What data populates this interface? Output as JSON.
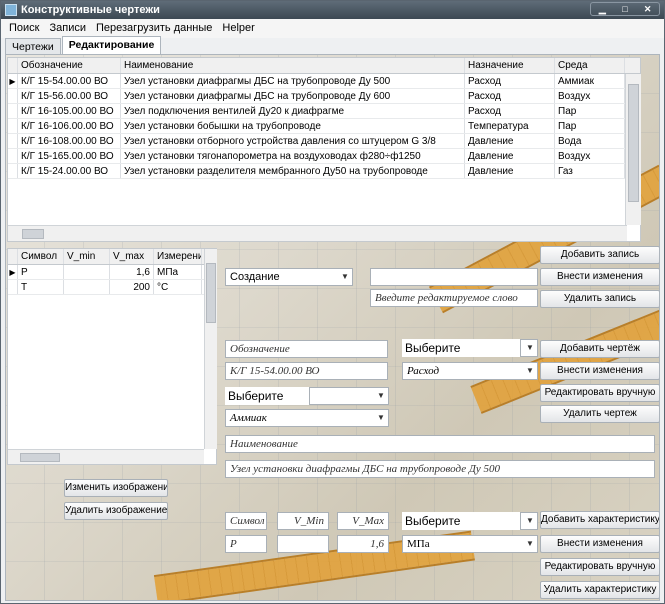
{
  "window": {
    "title": "Конструктивные чертежи"
  },
  "menu": {
    "items": [
      "Поиск",
      "Записи",
      "Перезагрузить данные",
      "Helper"
    ]
  },
  "tabs": [
    {
      "label": "Чертежи"
    },
    {
      "label": "Редактирование"
    }
  ],
  "drawings_table": {
    "columns": [
      "Обозначение",
      "Наименование",
      "Назначение",
      "Среда"
    ],
    "rows": [
      {
        "code": "К/Г 15-54.00.00 ВО",
        "name": "Узел установки диафрагмы ДБС на трубопроводе Ду 500",
        "purpose": "Расход",
        "medium": "Аммиак"
      },
      {
        "code": "К/Г 15-56.00.00 ВО",
        "name": "Узел установки диафрагмы ДБС на трубопроводе Ду 600",
        "purpose": "Расход",
        "medium": "Воздух"
      },
      {
        "code": "К/Г 16-105.00.00 ВО",
        "name": "Узел подключения вентилей Ду20 к диафрагме",
        "purpose": "Расход",
        "medium": "Пар"
      },
      {
        "code": "К/Г 16-106.00.00 ВО",
        "name": "Узел установки бобышки на трубопроводе",
        "purpose": "Температура",
        "medium": "Пар"
      },
      {
        "code": "К/Г 16-108.00.00 ВО",
        "name": "Узел установки отборного устройства давления со штуцером G 3/8",
        "purpose": "Давление",
        "medium": "Вода"
      },
      {
        "code": "К/Г 15-165.00.00 ВО",
        "name": "Узел установки тягонапорометра на воздуховодах ф280÷ф1250",
        "purpose": "Давление",
        "medium": "Воздух"
      },
      {
        "code": "К/Г 15-24.00.00 ВО",
        "name": "Узел установки разделителя мембранного Ду50 на трубопроводе",
        "purpose": "Давление",
        "medium": "Газ"
      }
    ]
  },
  "characteristics_table": {
    "columns": [
      "Символ",
      "V_min",
      "V_max",
      "Измерение"
    ],
    "rows": [
      {
        "symbol": "P",
        "vmin": "",
        "vmax": "1,6",
        "unit": "МПа"
      },
      {
        "symbol": "T",
        "vmin": "",
        "vmax": "200",
        "unit": "°С"
      }
    ]
  },
  "record_panel": {
    "mode_value": "Создание",
    "edit_word_placeholder": "Введите редактируемое слово",
    "edit_word_value": "",
    "add_record": "Добавить запись",
    "apply_changes": "Внести изменения",
    "delete_record": "Удалить запись"
  },
  "drawing_panel": {
    "code_placeholder": "Обозначение",
    "code_value": "К/Г 15-54.00.00 ВО",
    "purpose_label": "Выберите назначение",
    "purpose_value": "Расход",
    "medium_label": "Выберите среду",
    "medium_value": "Аммиак",
    "name_placeholder": "Наименование",
    "name_value": "Узел установки диафрагмы ДБС на трубопроводе Ду 500",
    "add_drawing": "Добавить чертёж",
    "apply_changes": "Внести изменения",
    "edit_manually": "Редактировать вручную",
    "delete_drawing": "Удалить чертеж"
  },
  "image_panel": {
    "change_image": "Изменить изображение",
    "delete_image": "Удалить изображение"
  },
  "characteristic_panel": {
    "symbol_placeholder": "Символ",
    "vmin_placeholder": "V_Min",
    "vmax_placeholder": "V_Max",
    "unit_label": "Выберите измерение",
    "symbol_value": "P",
    "vmin_value": "",
    "vmax_value": "1,6",
    "unit_value": "МПа",
    "add_characteristic": "Добавить характеристику",
    "apply_changes": "Внести изменения",
    "edit_manually": "Редактировать вручную",
    "delete_characteristic": "Удалить характеристику"
  },
  "colors": {
    "titlebar": "#4a5662",
    "ruler": "#e2a23b",
    "selection_marker": "#000000"
  }
}
